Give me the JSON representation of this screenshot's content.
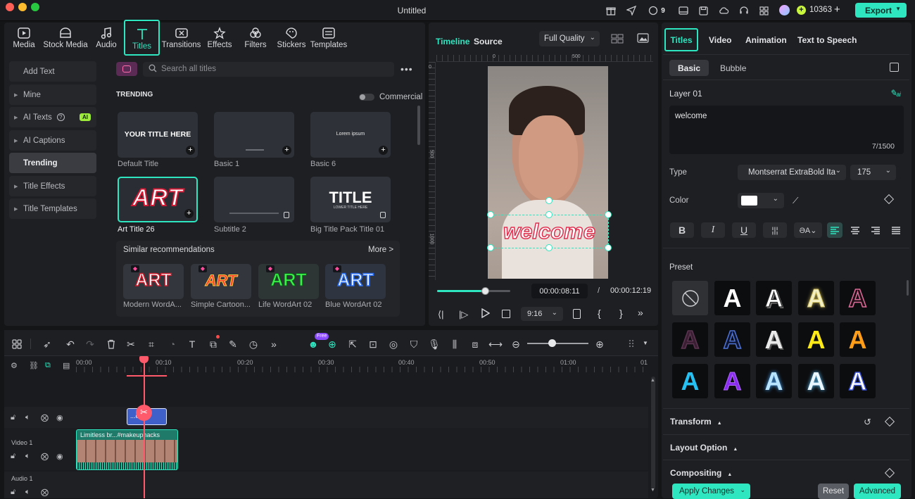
{
  "window": {
    "title": "Untitled"
  },
  "topbar": {
    "credits": "10363",
    "notif_count": "9",
    "export_label": "Export"
  },
  "media_tabs": [
    {
      "label": "Media",
      "icon": "media-icon"
    },
    {
      "label": "Stock Media",
      "icon": "stock-media-icon"
    },
    {
      "label": "Audio",
      "icon": "audio-icon"
    },
    {
      "label": "Titles",
      "icon": "titles-icon",
      "active": true
    },
    {
      "label": "Transitions",
      "icon": "transitions-icon"
    },
    {
      "label": "Effects",
      "icon": "effects-icon"
    },
    {
      "label": "Filters",
      "icon": "filters-icon"
    },
    {
      "label": "Stickers",
      "icon": "stickers-icon"
    },
    {
      "label": "Templates",
      "icon": "templates-icon"
    }
  ],
  "sidebar": {
    "items": [
      "Add Text",
      "Mine",
      "AI Texts",
      "AI Captions",
      "Trending",
      "Title Effects",
      "Title Templates"
    ],
    "ai_badge": "AI"
  },
  "library": {
    "search_placeholder": "Search all titles",
    "section": "TRENDING",
    "commercial_label": "Commercial",
    "cards": [
      {
        "name": "Default Title",
        "preview": "YOUR TITLE HERE"
      },
      {
        "name": "Basic 1",
        "preview": ""
      },
      {
        "name": "Basic 6",
        "preview": "Lorem ipsum"
      },
      {
        "name": "Art Title 26",
        "preview": "ART"
      },
      {
        "name": "Subtitle 2",
        "preview": ""
      },
      {
        "name": "Big Title Pack Title 01",
        "preview": "TITLE",
        "preview_sub": "LOWER TITLE HERE"
      }
    ],
    "similar": {
      "heading": "Similar recommendations",
      "more": "More >",
      "items": [
        {
          "name": "Modern WordA...",
          "preview": "ART"
        },
        {
          "name": "Simple Cartoon...",
          "preview": "ART"
        },
        {
          "name": "Life WordArt 02",
          "preview": "ART"
        },
        {
          "name": "Blue WordArt 02",
          "preview": "ART"
        }
      ]
    }
  },
  "preview": {
    "tab_timeline": "Timeline",
    "tab_source": "Source",
    "quality": "Full Quality",
    "overlay_text": "welcome",
    "current_time": "00:00:08:11",
    "separator": "/",
    "total_time": "00:00:12:19",
    "progress": 0.65,
    "aspect": "9:16",
    "ruler_h": [
      "0",
      "500"
    ],
    "ruler_v": [
      "0",
      "500",
      "1000"
    ]
  },
  "inspector": {
    "tabs": [
      "Titles",
      "Video",
      "Animation",
      "Text to Speech"
    ],
    "subtabs": [
      "Basic",
      "Bubble"
    ],
    "layer": "Layer 01",
    "text_value": "welcome",
    "char_count": "7/1500",
    "type_label": "Type",
    "font": "Montserrat ExtraBold Ita",
    "font_size": "175",
    "color_label": "Color",
    "preset_label": "Preset",
    "sections": [
      "Transform",
      "Layout Option",
      "Compositing"
    ],
    "apply_label": "Apply Changes",
    "reset_label": "Reset",
    "advanced_label": "Advanced"
  },
  "timeline": {
    "ticks": [
      "00:00",
      "00:10",
      "00:20",
      "00:30",
      "00:40",
      "00:50",
      "01:00",
      "01"
    ],
    "track_video": "Video 1",
    "track_audio": "Audio 1",
    "clip_label": "Limitless br...#makeuphacks",
    "title_clip": "...e",
    "new_badge": "Free"
  },
  "colors": {
    "accent": "#2ee6c0",
    "accent_text": "#0f2e28",
    "panel": "#1e1f23"
  }
}
